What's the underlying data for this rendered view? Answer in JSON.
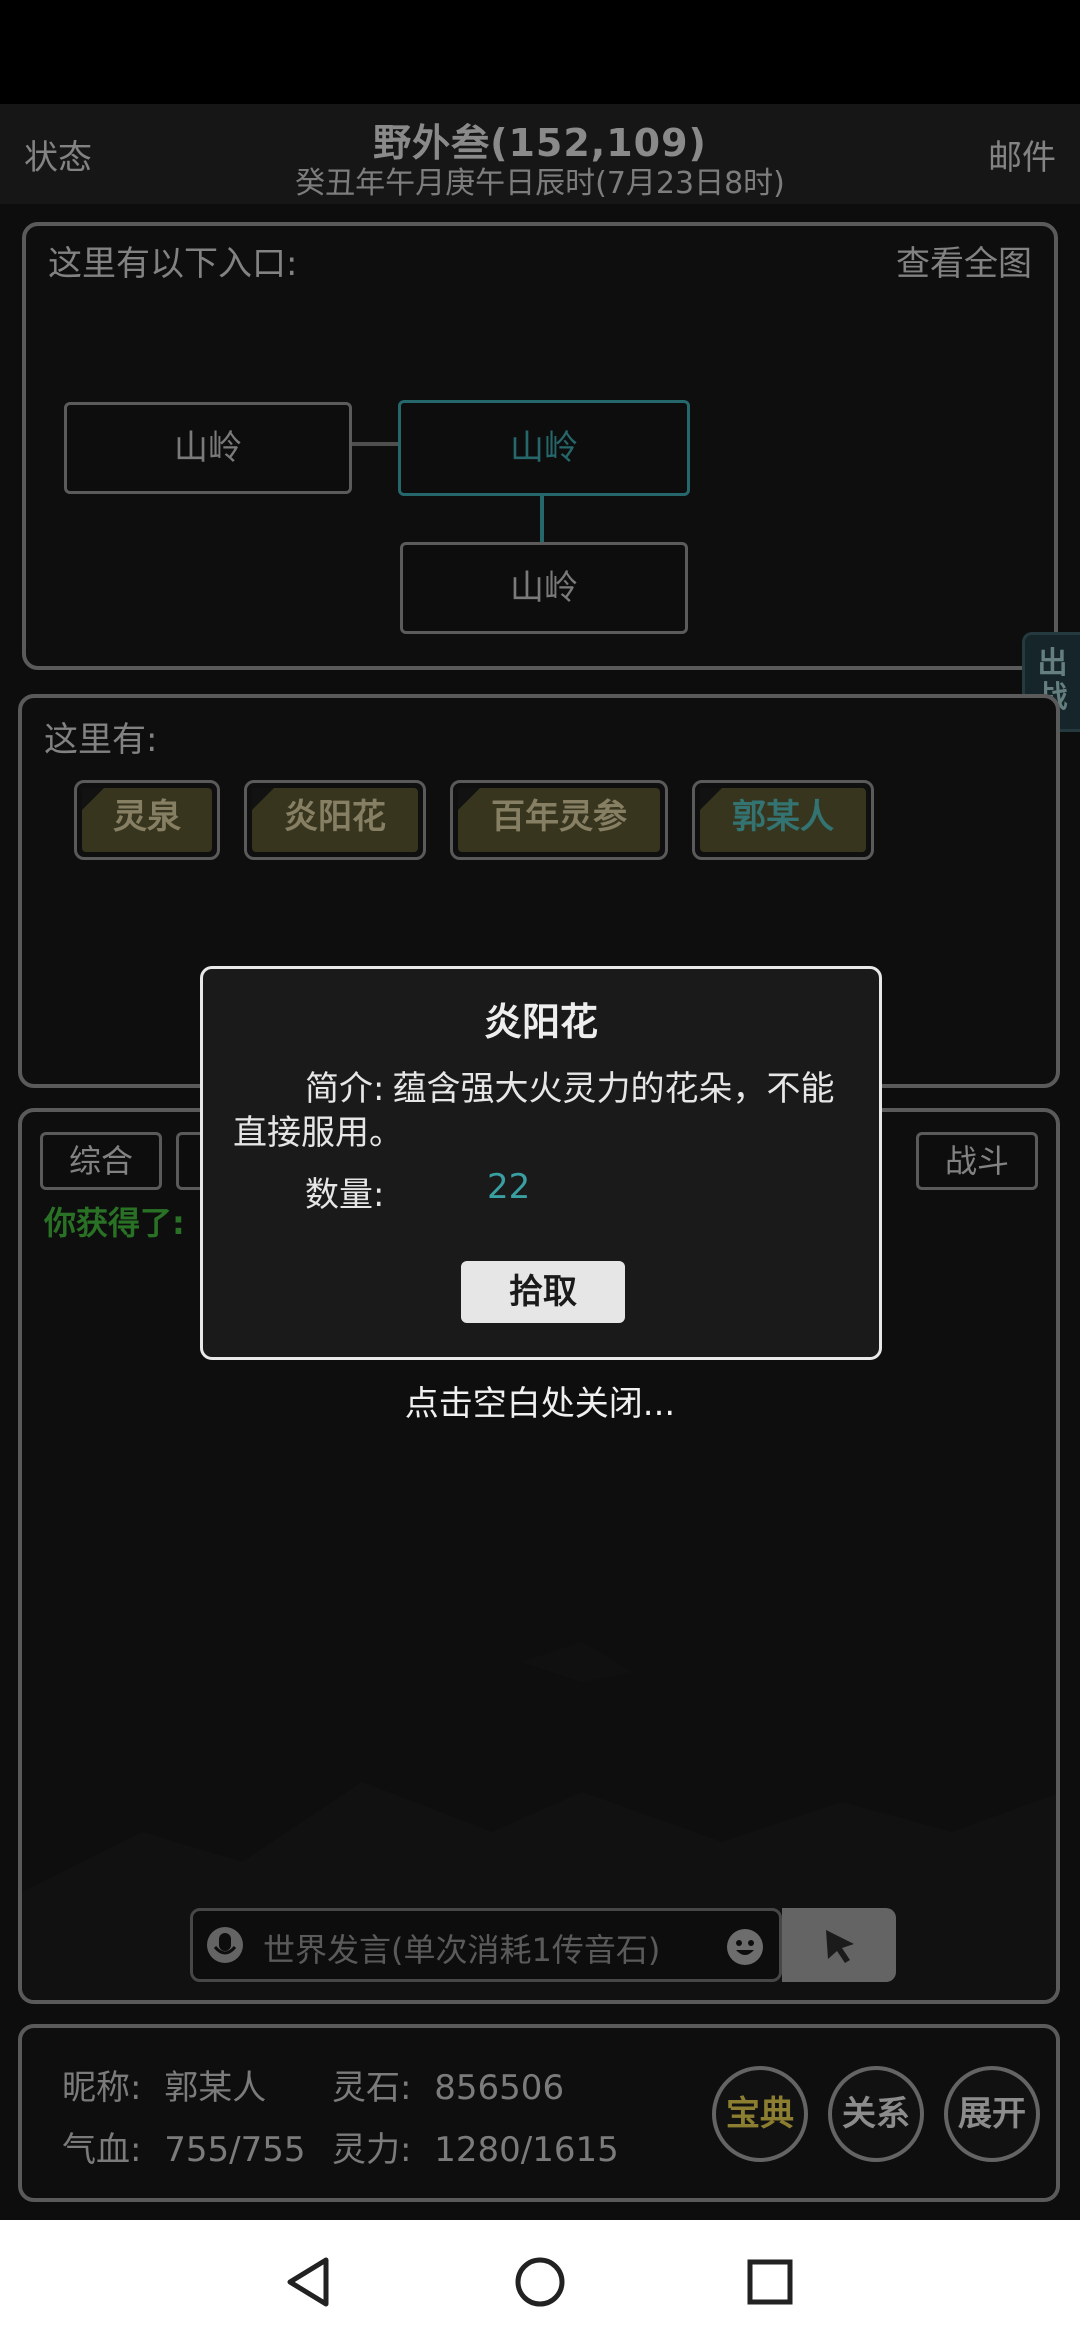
{
  "header": {
    "left": "状态",
    "right": "邮件",
    "location": "野外叁(152,109)",
    "datetime": "癸丑年午月庚午日辰时(7月23日8时)"
  },
  "exits": {
    "title": "这里有以下入口:",
    "view_map": "查看全图",
    "nodes": [
      "山岭",
      "山岭",
      "山岭"
    ]
  },
  "side_tab": "出\n战",
  "here": {
    "title": "这里有:",
    "items": [
      "灵泉",
      "炎阳花",
      "百年灵参",
      "郭某人"
    ]
  },
  "chat": {
    "tabs": [
      "综合",
      "战斗"
    ],
    "gain_text": "你获得了:",
    "input_placeholder": "世界发言(单次消耗1传音石)"
  },
  "modal": {
    "title": "炎阳花",
    "desc_label": "简介:",
    "desc": "蕴含强大火灵力的花朵，不能直接服用。",
    "qty_label": "数量:",
    "qty_value": "22",
    "button": "拾取",
    "close_hint": "点击空白处关闭..."
  },
  "stats": {
    "nickname_label": "昵称:",
    "nickname": "郭某人",
    "stone_label": "灵石:",
    "stone": "856506",
    "hp_label": "气血:",
    "hp": "755/755",
    "mp_label": "灵力:",
    "mp": "1280/1615",
    "buttons": [
      "宝典",
      "关系",
      "展开"
    ]
  },
  "colors": {
    "accent_teal": "#3a9fa3",
    "gain_green": "#3fae3a",
    "gold": "#d6c24a"
  }
}
